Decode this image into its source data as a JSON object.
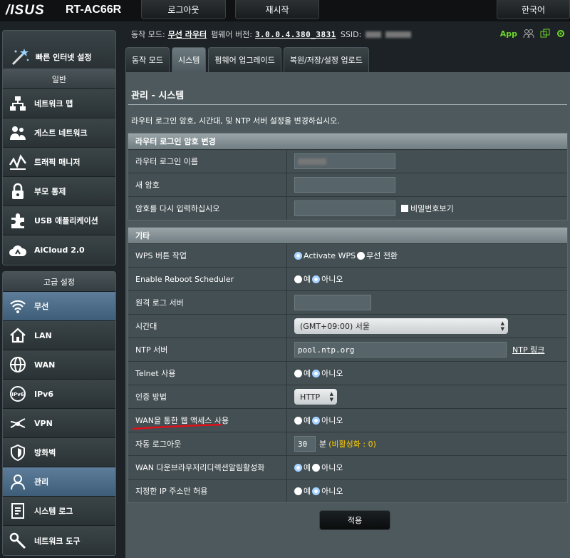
{
  "header": {
    "logo": "/ISUS",
    "model": "RT-AC66R",
    "logout": "로그아웃",
    "reboot": "재시작",
    "language": "한국어"
  },
  "status": {
    "mode_label": "동작 모드:",
    "mode_value": "무선 라우터",
    "fw_label": "펌웨어 버전:",
    "fw_value": "3.0.0.4.380_3831",
    "ssid_label": "SSID:",
    "app_label": "App"
  },
  "sidebar": {
    "quick_setup": "빠른 인터넷 설정",
    "general_header": "일반",
    "general_items": [
      {
        "label": "네트워크 맵",
        "icon": "network-map-icon"
      },
      {
        "label": "게스트 네트워크",
        "icon": "guest-network-icon"
      },
      {
        "label": "트래픽 매니저",
        "icon": "traffic-manager-icon"
      },
      {
        "label": "부모 통제",
        "icon": "parental-control-icon"
      },
      {
        "label": "USB 애플리케이션",
        "icon": "usb-app-icon"
      },
      {
        "label": "AiCloud 2.0",
        "icon": "aicloud-icon"
      }
    ],
    "advanced_header": "고급 설정",
    "advanced_items": [
      {
        "label": "무선",
        "icon": "wireless-icon"
      },
      {
        "label": "LAN",
        "icon": "lan-icon"
      },
      {
        "label": "WAN",
        "icon": "wan-icon"
      },
      {
        "label": "IPv6",
        "icon": "ipv6-icon"
      },
      {
        "label": "VPN",
        "icon": "vpn-icon"
      },
      {
        "label": "방화벽",
        "icon": "firewall-icon"
      },
      {
        "label": "관리",
        "icon": "administration-icon"
      },
      {
        "label": "시스템 로그",
        "icon": "system-log-icon"
      },
      {
        "label": "네트워크 도구",
        "icon": "network-tools-icon"
      }
    ]
  },
  "tabs": [
    "동작 모드",
    "시스템",
    "펌웨어 업그레이드",
    "복원/저장/설정 업로드"
  ],
  "page": {
    "title": "관리 - 시스템",
    "description": "라우터 로그인 암호, 시간대, 및 NTP 서버 설정을 변경하십시오."
  },
  "login_section": {
    "header": "라우터 로그인 암호 변경",
    "username_label": "라우터 로그인 이름",
    "new_password_label": "새 암호",
    "retype_label": "암호를 다시 입력하십시오",
    "show_password": "비밀번호보기"
  },
  "misc_section": {
    "header": "기타",
    "wps_label": "WPS 버튼 작업",
    "wps_opt1": "Activate WPS",
    "wps_opt2": "무선 전환",
    "reboot_sched_label": "Enable Reboot Scheduler",
    "yes": "예",
    "no": "아니오",
    "remote_log_label": "원격 로그 서버",
    "timezone_label": "시간대",
    "timezone_value": "(GMT+09:00) 서울",
    "ntp_label": "NTP 서버",
    "ntp_value": "pool.ntp.org",
    "ntp_link": "NTP 링크",
    "telnet_label": "Telnet 사용",
    "auth_label": "인증 방법",
    "auth_value": "HTTP",
    "wan_access_label": "WAN을 통한 웹 액세스 사용",
    "auto_logout_label": "자동 로그아웃",
    "auto_logout_value": "30",
    "auto_logout_unit": "분",
    "auto_logout_hint": "(비활성화 : 0)",
    "wan_redirect_label": "WAN 다운브라우저리디렉션알림활성화",
    "ip_allow_label": "지정한 IP 주소만 허용"
  },
  "apply": "적용",
  "colors": {
    "accent": "#2f8be8",
    "app_green": "#6fd52b",
    "hint_yellow": "#ffcc00",
    "annotation_red": "#e0101a"
  }
}
